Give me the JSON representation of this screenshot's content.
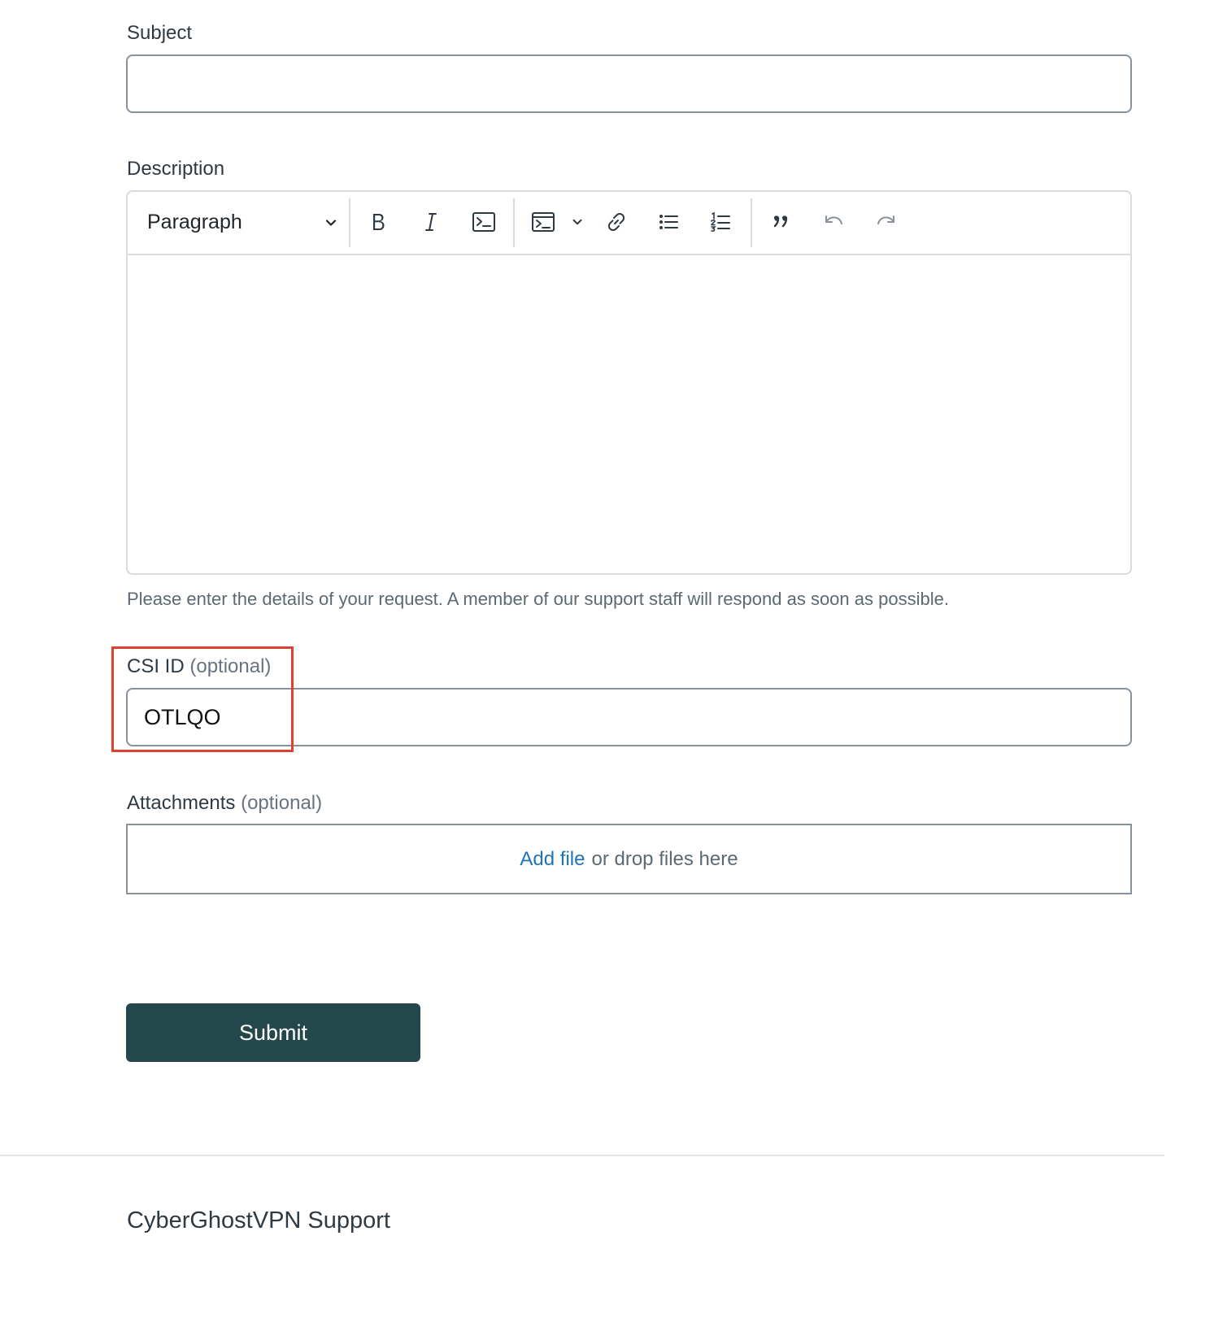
{
  "form": {
    "subject": {
      "label": "Subject",
      "value": ""
    },
    "description": {
      "label": "Description",
      "block_format": "Paragraph",
      "body": "",
      "hint": "Please enter the details of your request. A member of our support staff will respond as soon as possible.",
      "toolbar_icons": [
        "bold-icon",
        "italic-icon",
        "code-icon",
        "code-block-icon",
        "link-icon",
        "bulleted-list-icon",
        "numbered-list-icon",
        "blockquote-icon",
        "undo-icon",
        "redo-icon"
      ]
    },
    "csi_id": {
      "label": "CSI ID",
      "optional": "(optional)",
      "value": "OTLQO"
    },
    "attachments": {
      "label": "Attachments",
      "optional": "(optional)",
      "add_file": "Add file",
      "drop_text": "or drop files here"
    },
    "submit_label": "Submit"
  },
  "footer": {
    "brand": "CyberGhostVPN Support"
  },
  "colors": {
    "highlight": "#e0402d",
    "submit_bg": "#24474b",
    "link": "#1f73b7"
  }
}
